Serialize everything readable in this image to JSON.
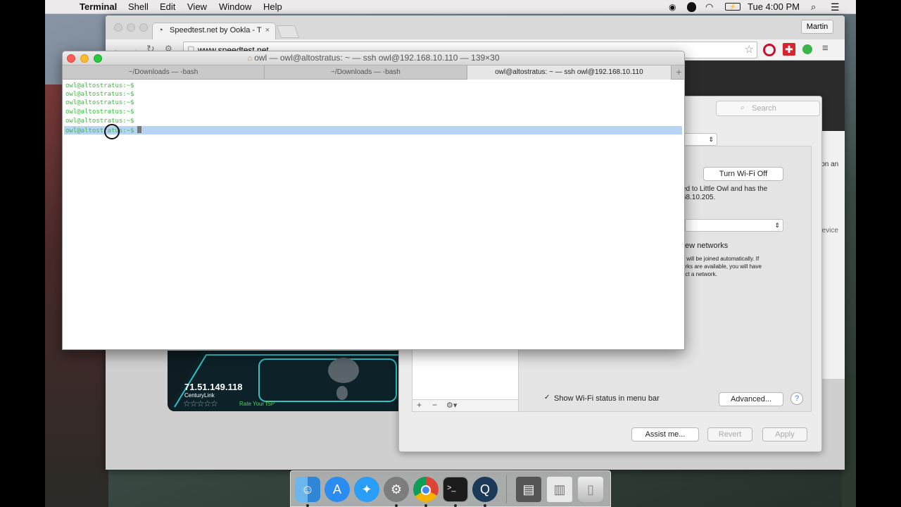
{
  "menubar": {
    "app": "Terminal",
    "items": [
      "Shell",
      "Edit",
      "View",
      "Window",
      "Help"
    ],
    "clock": "Tue 4:00 PM",
    "icons": [
      "apple-icon",
      "record-icon",
      "notification-icon",
      "wifi-icon",
      "battery-icon",
      "spotlight-icon",
      "notification-center-icon"
    ]
  },
  "chrome": {
    "tab_title": "Speedtest.net by Ookla - T",
    "user": "Martin",
    "url": "www.speedtest.net"
  },
  "speedtest": {
    "ip": "71.51.149.118",
    "isp": "CenturyLink",
    "rate_label": "Rate Your ISP"
  },
  "prefs": {
    "search_placeholder": "Search",
    "turn_off_button": "Turn Wi-Fi Off",
    "status_text_1": "ed to Little Owl and has the",
    "status_text_2": "68.10.205.",
    "ask_label": "new networks",
    "ask_desc_1": "s will be joined automatically. If",
    "ask_desc_2": "orks are available, you will have",
    "ask_desc_3": "ect a network.",
    "show_status_label": "Show Wi-Fi status in menu bar",
    "advanced_button": "Advanced...",
    "help_button": "?",
    "assist_button": "Assist me...",
    "revert_button": "Revert",
    "apply_button": "Apply",
    "side_text_1": "ion an",
    "side_text_2": "device"
  },
  "terminal": {
    "title": "owl — owl@altostratus: ~ — ssh owl@192.168.10.110 — 139×30",
    "tabs": [
      "~/Downloads — -bash",
      "~/Downloads — -bash",
      "owl@altostratus: ~ — ssh owl@192.168.10.110"
    ],
    "prompt": "owl@altostratus:~$",
    "lines": 6
  },
  "dock": {
    "apps": [
      "finder-icon",
      "app-store-icon",
      "safari-icon",
      "system-preferences-icon",
      "chrome-icon",
      "terminal-icon",
      "quicktime-icon",
      "scanner-icon",
      "preview-icon",
      "trash-icon"
    ]
  }
}
